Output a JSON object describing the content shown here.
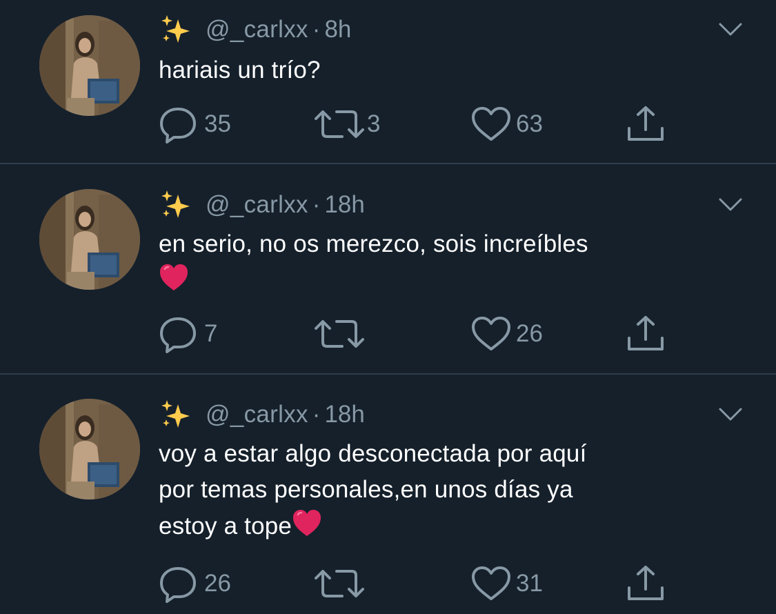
{
  "colors": {
    "background": "#15202b",
    "divider": "#2f3d4c",
    "secondary_text": "#8899a6",
    "primary_text": "#ffffff",
    "heart_emoji": "#e0245e"
  },
  "tweets": [
    {
      "handle": "@_carlxx",
      "separator": "·",
      "time": "8h",
      "text_lines": [
        "hariais un trío?"
      ],
      "emoji_after": "",
      "replies": "35",
      "retweets": "3",
      "likes": "63",
      "icons": [
        "sparkles-icon",
        "chevron-down-icon",
        "reply-icon",
        "retweet-icon",
        "like-icon",
        "share-icon"
      ]
    },
    {
      "handle": "@_carlxx",
      "separator": "·",
      "time": "18h",
      "text_lines": [
        "en serio, no os merezco, sois increíbles"
      ],
      "emoji_after": "red-heart",
      "replies": "7",
      "retweets": "",
      "likes": "26"
    },
    {
      "handle": "@_carlxx",
      "separator": "·",
      "time": "18h",
      "text_lines": [
        "voy a estar algo desconectada por aquí",
        "por temas personales,en unos días ya",
        "estoy a tope"
      ],
      "emoji_after": "red-heart",
      "replies": "26",
      "retweets": "",
      "likes": "31"
    }
  ]
}
